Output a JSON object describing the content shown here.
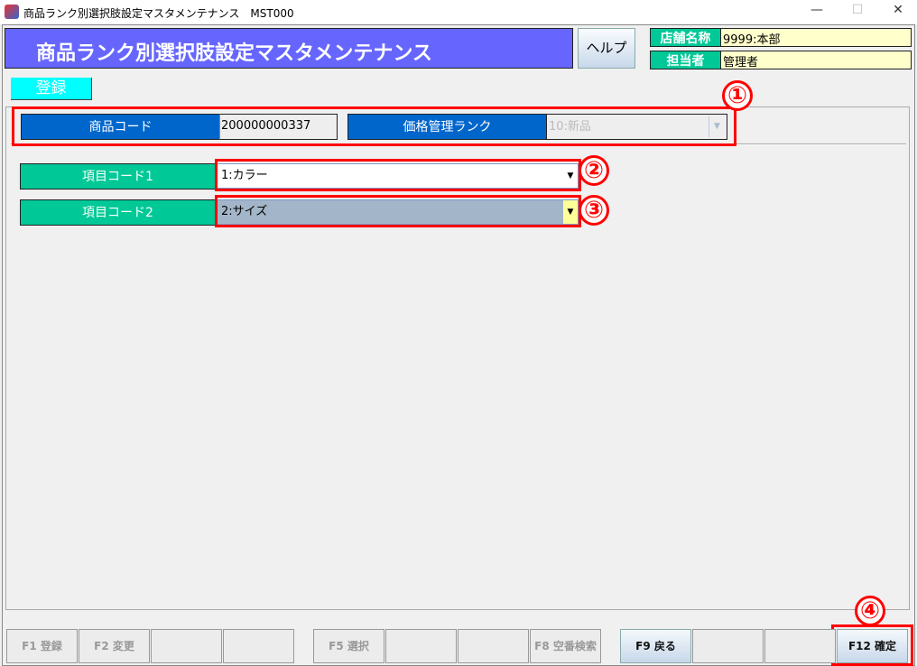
{
  "window": {
    "title": "商品ランク別選択肢設定マスタメンテナンス　MST000",
    "minimize": "—",
    "maximize": "☐",
    "close": "✕"
  },
  "header": {
    "title": "商品ランク別選択肢設定マスタメンテナンス",
    "help_label": "ヘルプ"
  },
  "info": {
    "store_label": "店舗名称",
    "store_value": "9999:本部",
    "staff_label": "担当者",
    "staff_value": "管理者"
  },
  "mode_button": "登録",
  "top": {
    "product_code_label": "商品コード",
    "product_code_value": "200000000337",
    "price_rank_label": "価格管理ランク",
    "price_rank_value": "10:新品"
  },
  "items": [
    {
      "label": "項目コード1",
      "value": "1:カラー"
    },
    {
      "label": "項目コード2",
      "value": "2:サイズ"
    }
  ],
  "annotations": [
    "①",
    "②",
    "③",
    "④"
  ],
  "fkeys": [
    {
      "label": "F1 登録",
      "enabled": false
    },
    {
      "label": "F2 変更",
      "enabled": false
    },
    {
      "label": "",
      "enabled": false
    },
    {
      "label": "",
      "enabled": false
    },
    {
      "label": "F5 選択",
      "enabled": false
    },
    {
      "label": "",
      "enabled": false
    },
    {
      "label": "",
      "enabled": false
    },
    {
      "label": "F8 空番検索",
      "enabled": false
    },
    {
      "label": "F9 戻る",
      "enabled": true
    },
    {
      "label": "",
      "enabled": false
    },
    {
      "label": "",
      "enabled": false
    },
    {
      "label": "F12 確定",
      "enabled": true
    }
  ]
}
